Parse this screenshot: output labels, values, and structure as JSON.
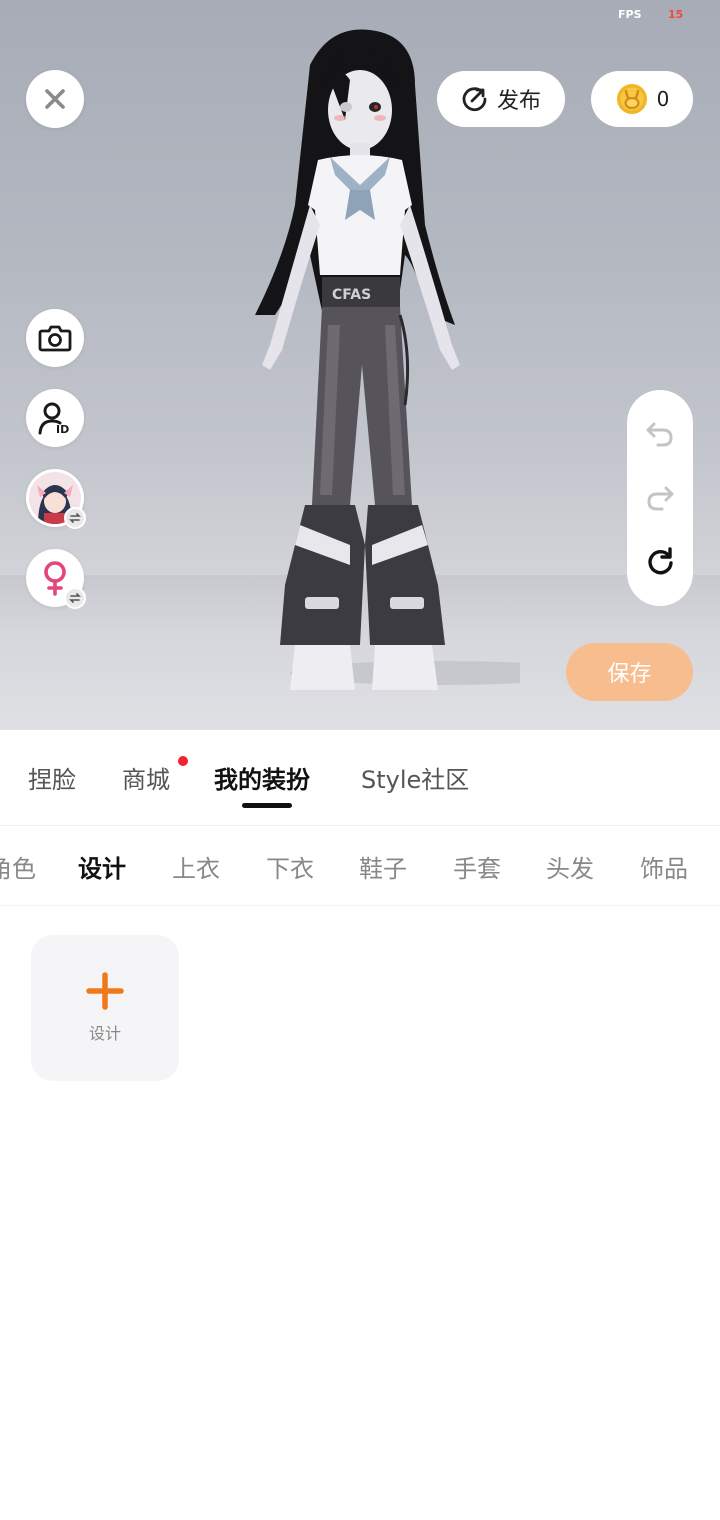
{
  "status": {
    "fps_label": "FPS",
    "fps_value": "15"
  },
  "top_bar": {
    "publish_label": "发布",
    "coin_count": "0"
  },
  "actions": {
    "save_label": "保存"
  },
  "main_tabs": {
    "items": [
      {
        "label": "捏脸"
      },
      {
        "label": "商城",
        "badge": "red-dot"
      },
      {
        "label": "我的装扮",
        "active": true
      },
      {
        "label": "Style社区"
      }
    ]
  },
  "sub_tabs": {
    "items": [
      {
        "label": "角色"
      },
      {
        "label": "设计",
        "active": true
      },
      {
        "label": "上衣"
      },
      {
        "label": "下衣"
      },
      {
        "label": "鞋子"
      },
      {
        "label": "手套"
      },
      {
        "label": "头发"
      },
      {
        "label": "饰品"
      }
    ]
  },
  "design_card": {
    "label": "设计"
  },
  "colors": {
    "accent_orange": "#f07a1a",
    "save_button": "#f8bd8e",
    "badge_red": "#f5222d",
    "coin_gold": "#f2b526"
  },
  "icons": {
    "close": "close-icon",
    "camera": "camera-icon",
    "avatar_id": "user-id-icon",
    "character_swap": "character-avatar",
    "gender": "female-icon",
    "publish": "publish-icon",
    "coin": "coin-icon",
    "undo": "undo-icon",
    "redo": "redo-icon",
    "reset": "reset-icon",
    "add": "plus-icon"
  }
}
